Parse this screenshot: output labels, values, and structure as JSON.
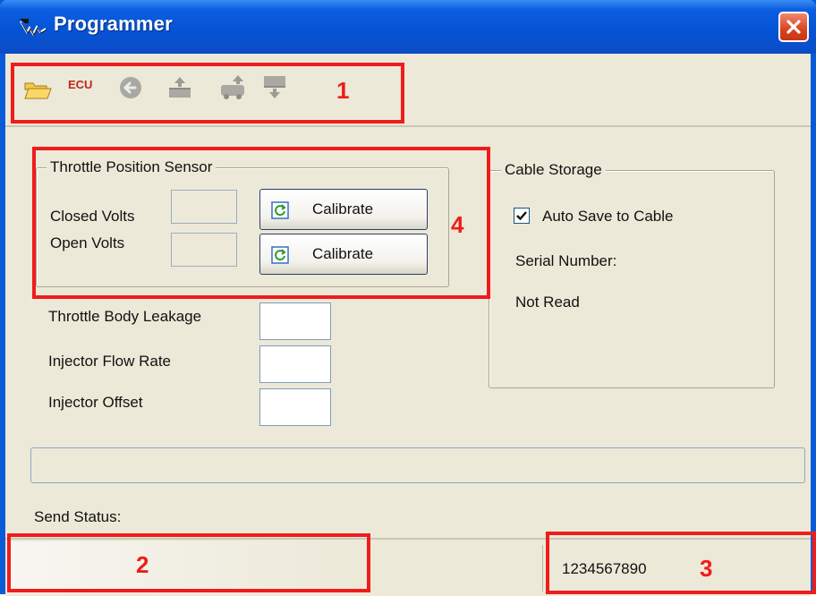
{
  "window": {
    "title": "Programmer"
  },
  "toolbar": {
    "buttons": [
      {
        "icon": "open-folder-icon",
        "enabled": true
      },
      {
        "icon": "ecu-icon",
        "label": "ECU",
        "enabled": true
      },
      {
        "icon": "back-arrow-icon",
        "enabled": false
      },
      {
        "icon": "upload-icon",
        "enabled": false
      },
      {
        "icon": "upload-vehicle-icon",
        "enabled": false
      },
      {
        "icon": "download-icon",
        "enabled": false
      }
    ]
  },
  "annotations": {
    "one": "1",
    "two": "2",
    "three": "3",
    "four": "4"
  },
  "tps": {
    "title": "Throttle Position Sensor",
    "closed_label": "Closed Volts",
    "open_label": "Open Volts",
    "closed_value": "",
    "open_value": "",
    "calibrate_label": "Calibrate"
  },
  "fields": [
    {
      "label": "Throttle Body Leakage",
      "value": ""
    },
    {
      "label": "Injector Flow Rate",
      "value": ""
    },
    {
      "label": "Injector Offset",
      "value": ""
    }
  ],
  "cable": {
    "title": "Cable Storage",
    "auto_save_label": "Auto Save to Cable",
    "auto_save_checked": true,
    "serial_label": "Serial Number:",
    "serial_value": "Not Read"
  },
  "send_status_label": "Send Status:",
  "statusbar": {
    "left_text": "",
    "serial": "1234567890"
  },
  "colors": {
    "title_blue": "#0653d6",
    "annotation_red": "#ef1c1c",
    "face": "#ece9d8",
    "ecu_red": "#c0271c"
  }
}
